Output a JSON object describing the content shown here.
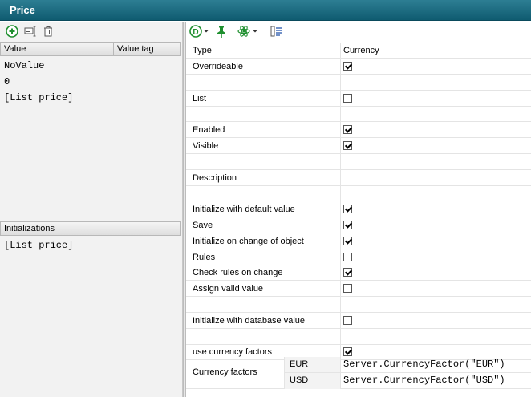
{
  "window": {
    "title": "Price"
  },
  "left": {
    "toolbar": {
      "add_icon": "add-circle-icon",
      "edit_icon": "edit-tag-icon",
      "delete_icon": "trash-icon"
    },
    "values_table": {
      "columns": [
        "Value",
        "Value tag"
      ],
      "rows": [
        "NoValue",
        "0",
        "[List price]"
      ]
    },
    "initializations": {
      "header": "Initializations",
      "rows": [
        "[List price]"
      ]
    }
  },
  "right": {
    "toolbar": {
      "d_icon": "d-circle-dropdown-icon",
      "pin_icon": "pin-icon",
      "atom_icon": "atom-dropdown-icon",
      "list_icon": "list-icon"
    },
    "type_row": {
      "label": "Type",
      "value": "Currency"
    },
    "properties": [
      {
        "label": "Overrideable",
        "checked": true
      },
      {
        "label": "",
        "checked": null
      },
      {
        "label": "List",
        "checked": false
      },
      {
        "label": "",
        "checked": null
      },
      {
        "label": "Enabled",
        "checked": true
      },
      {
        "label": "Visible",
        "checked": true
      },
      {
        "label": "",
        "checked": null
      },
      {
        "label": "Description",
        "checked": null
      },
      {
        "label": "",
        "checked": null
      },
      {
        "label": "Initialize with default value",
        "checked": true
      },
      {
        "label": "Save",
        "checked": true
      },
      {
        "label": "Initialize on change of object",
        "checked": true
      },
      {
        "label": "Rules",
        "checked": false
      },
      {
        "label": "Check rules on change",
        "checked": true
      },
      {
        "label": "Assign valid value",
        "checked": false
      },
      {
        "label": "",
        "checked": null
      },
      {
        "label": "Initialize with database value",
        "checked": false
      },
      {
        "label": "",
        "checked": null
      },
      {
        "label": "use currency factors",
        "checked": true
      }
    ],
    "currency_factors": {
      "label": "Currency factors",
      "rows": [
        {
          "currency": "EUR",
          "expression": "Server.CurrencyFactor(\"EUR\")"
        },
        {
          "currency": "USD",
          "expression": "Server.CurrencyFactor(\"USD\")"
        }
      ]
    }
  }
}
